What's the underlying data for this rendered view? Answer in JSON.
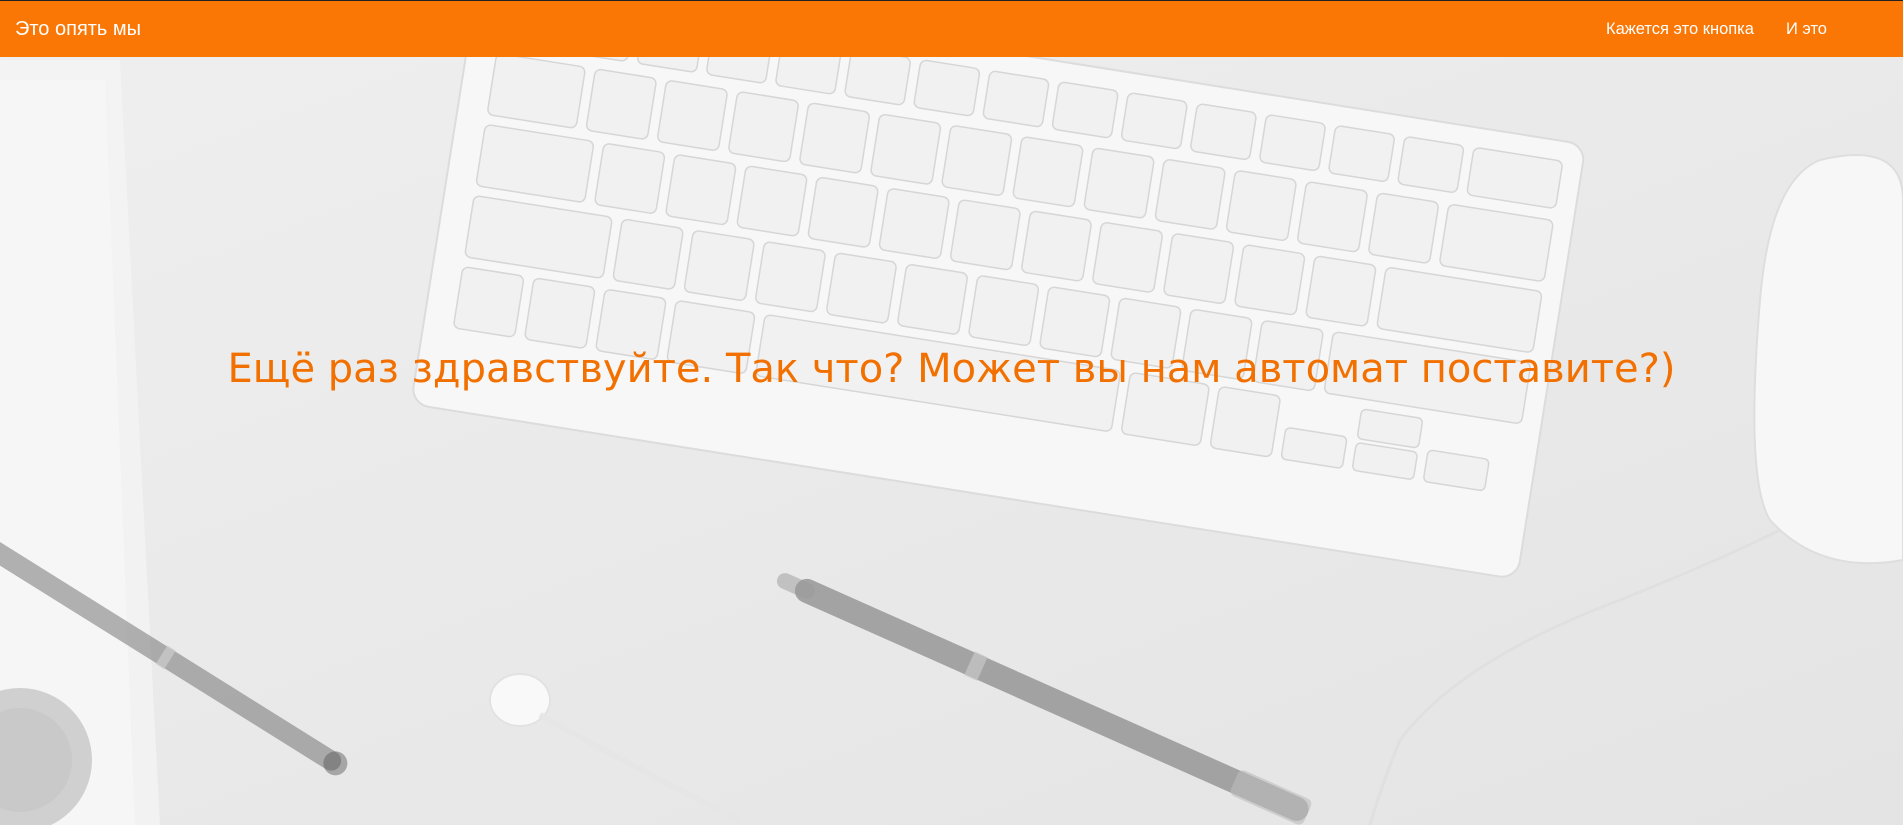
{
  "navbar": {
    "brand": "Это опять мы",
    "links": [
      {
        "label": "Кажется это кнопка"
      },
      {
        "label": "И это"
      }
    ],
    "color": "#fb7705"
  },
  "hero": {
    "headline": "Ещё раз здравствуйте. Так что? Может вы нам автомат поставите?)",
    "headline_color": "#f27000",
    "background_image": "desk-keyboard-pen-mouse"
  }
}
